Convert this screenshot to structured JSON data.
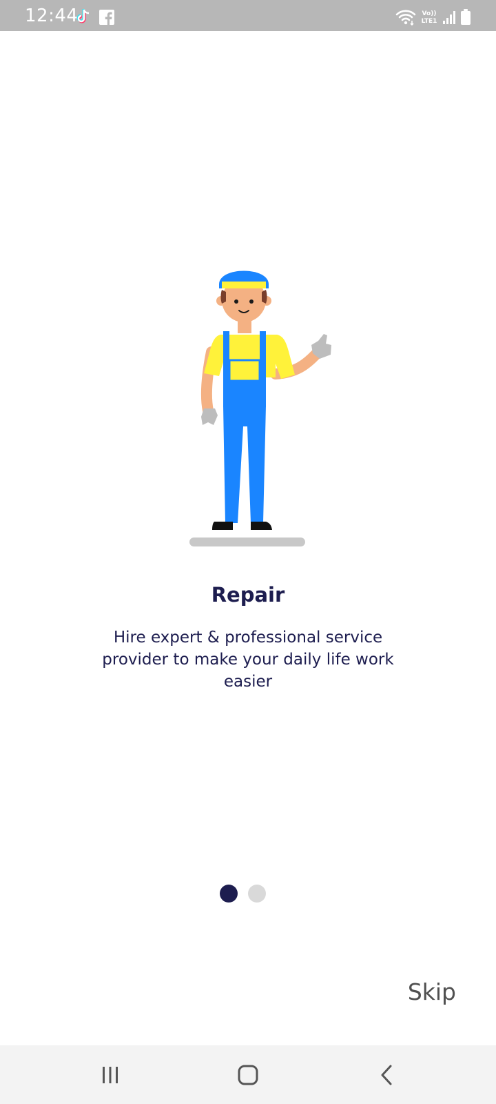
{
  "status_bar": {
    "time": "12:44",
    "left_icons": [
      "tiktok-icon",
      "facebook-icon"
    ],
    "right_icons": [
      "wifi-icon",
      "volte-icon",
      "signal-icon",
      "battery-icon"
    ],
    "volte_label": "Vo)) LTE1"
  },
  "onboarding": {
    "illustration": "repair-worker-illustration",
    "title": "Repair",
    "description": "Hire expert & professional service provider to make your daily life work easier",
    "pages": 2,
    "current_page": 1
  },
  "actions": {
    "skip_label": "Skip"
  },
  "nav_bar": {
    "buttons": [
      "recents-icon",
      "home-icon",
      "back-icon"
    ]
  },
  "colors": {
    "primary": "#1d1d4f",
    "inactive_dot": "#d9d9d9",
    "status_bar": "#b7b7b7",
    "nav_bar": "#f3f3f3"
  }
}
